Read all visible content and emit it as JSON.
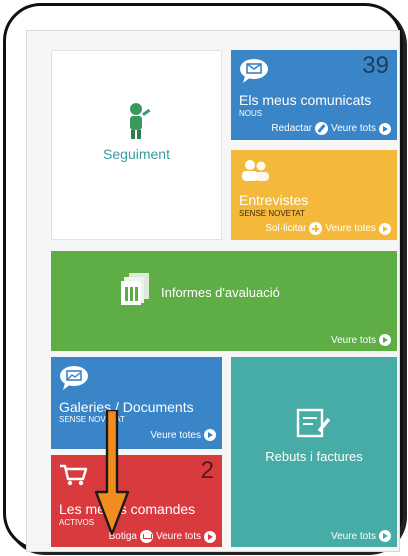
{
  "tiles": {
    "seguiment": {
      "title": "Seguiment",
      "icon": "student-icon"
    },
    "comunicats": {
      "title": "Els meus comunicats",
      "subtitle": "NOUS",
      "count": "39",
      "action1": "Redactar",
      "action2": "Veure tots",
      "icon": "chat-envelope-icon",
      "color": "#3a84c8"
    },
    "entrevistes": {
      "title": "Entrevistes",
      "subtitle": "SENSE NOVETAT",
      "action1": "Sol·licitar",
      "action2": "Veure totes",
      "icon": "people-icon",
      "color": "#f4b93b"
    },
    "informes": {
      "title": "Informes d'avaluació",
      "action": "Veure tots",
      "icon": "documents-icon",
      "color": "#5fad45"
    },
    "galeries": {
      "title": "Galeries / Documents",
      "subtitle": "SENSE NOVETAT",
      "action": "Veure totes",
      "icon": "chat-image-icon",
      "color": "#3a84c8"
    },
    "comandes": {
      "title": "Les meves comandes",
      "subtitle": "ACTIVOS",
      "count": "2",
      "action1": "Botiga",
      "action2": "Veure tots",
      "icon": "shopping-cart-icon",
      "color": "#d93a3e"
    },
    "rebuts": {
      "title": "Rebuts i factures",
      "action": "Veure tots",
      "icon": "receipt-icon",
      "color": "#47aba6"
    }
  },
  "annotation": {
    "type": "arrow",
    "color": "#f28c1e",
    "direction": "down"
  }
}
